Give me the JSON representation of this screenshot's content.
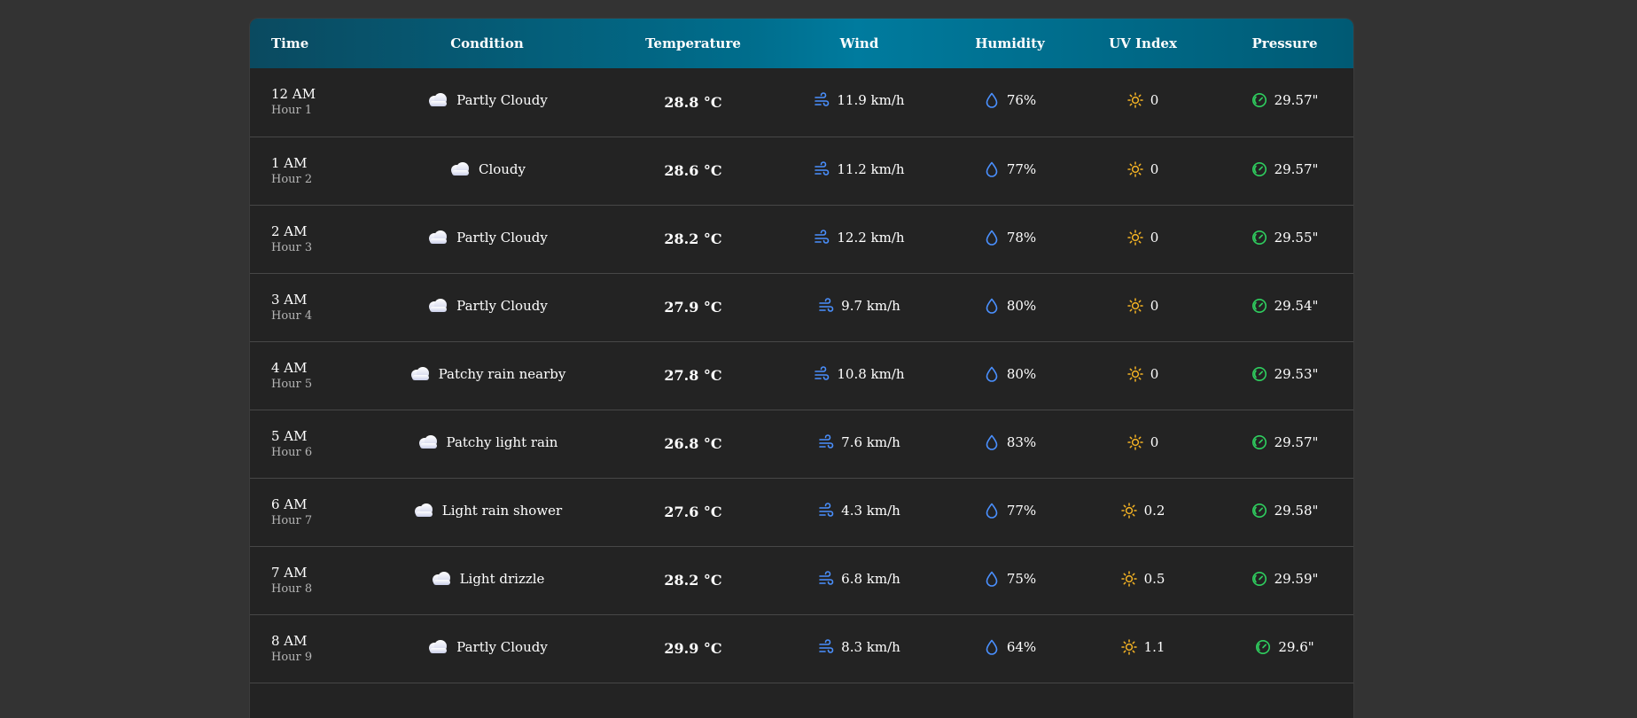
{
  "colors": {
    "wind": "#4a90ff",
    "humidity": "#4a90ff",
    "uv": "#f4b324",
    "pressure": "#2fcf5f"
  },
  "headers": {
    "time": "Time",
    "condition": "Condition",
    "temperature": "Temperature",
    "wind": "Wind",
    "humidity": "Humidity",
    "uv": "UV Index",
    "pressure": "Pressure"
  },
  "rows": [
    {
      "time": "12 AM",
      "hour": "Hour 1",
      "condition": "Partly Cloudy",
      "condition_icon": "partly-cloudy-icon",
      "temp": "28.8 °C",
      "wind": "11.9 km/h",
      "humidity": "76%",
      "uv": "0",
      "pressure": "29.57\""
    },
    {
      "time": "1 AM",
      "hour": "Hour 2",
      "condition": "Cloudy",
      "condition_icon": "cloudy-icon",
      "temp": "28.6 °C",
      "wind": "11.2 km/h",
      "humidity": "77%",
      "uv": "0",
      "pressure": "29.57\""
    },
    {
      "time": "2 AM",
      "hour": "Hour 3",
      "condition": "Partly Cloudy",
      "condition_icon": "partly-cloudy-icon",
      "temp": "28.2 °C",
      "wind": "12.2 km/h",
      "humidity": "78%",
      "uv": "0",
      "pressure": "29.55\""
    },
    {
      "time": "3 AM",
      "hour": "Hour 4",
      "condition": "Partly Cloudy",
      "condition_icon": "partly-cloudy-icon",
      "temp": "27.9 °C",
      "wind": "9.7 km/h",
      "humidity": "80%",
      "uv": "0",
      "pressure": "29.54\""
    },
    {
      "time": "4 AM",
      "hour": "Hour 5",
      "condition": "Patchy rain nearby",
      "condition_icon": "patchy-rain-icon",
      "temp": "27.8 °C",
      "wind": "10.8 km/h",
      "humidity": "80%",
      "uv": "0",
      "pressure": "29.53\""
    },
    {
      "time": "5 AM",
      "hour": "Hour 6",
      "condition": "Patchy light rain",
      "condition_icon": "light-rain-icon",
      "temp": "26.8 °C",
      "wind": "7.6 km/h",
      "humidity": "83%",
      "uv": "0",
      "pressure": "29.57\""
    },
    {
      "time": "6 AM",
      "hour": "Hour 7",
      "condition": "Light rain shower",
      "condition_icon": "rain-shower-icon",
      "temp": "27.6 °C",
      "wind": "4.3 km/h",
      "humidity": "77%",
      "uv": "0.2",
      "pressure": "29.58\""
    },
    {
      "time": "7 AM",
      "hour": "Hour 8",
      "condition": "Light drizzle",
      "condition_icon": "drizzle-icon",
      "temp": "28.2 °C",
      "wind": "6.8 km/h",
      "humidity": "75%",
      "uv": "0.5",
      "pressure": "29.59\""
    },
    {
      "time": "8 AM",
      "hour": "Hour 9",
      "condition": "Partly Cloudy",
      "condition_icon": "partly-cloudy-icon",
      "temp": "29.9 °C",
      "wind": "8.3 km/h",
      "humidity": "64%",
      "uv": "1.1",
      "pressure": "29.6\""
    },
    {
      "time": "",
      "hour": "",
      "condition": "",
      "condition_icon": "",
      "temp": "",
      "wind": "",
      "humidity": "",
      "uv": "",
      "pressure": ""
    }
  ]
}
